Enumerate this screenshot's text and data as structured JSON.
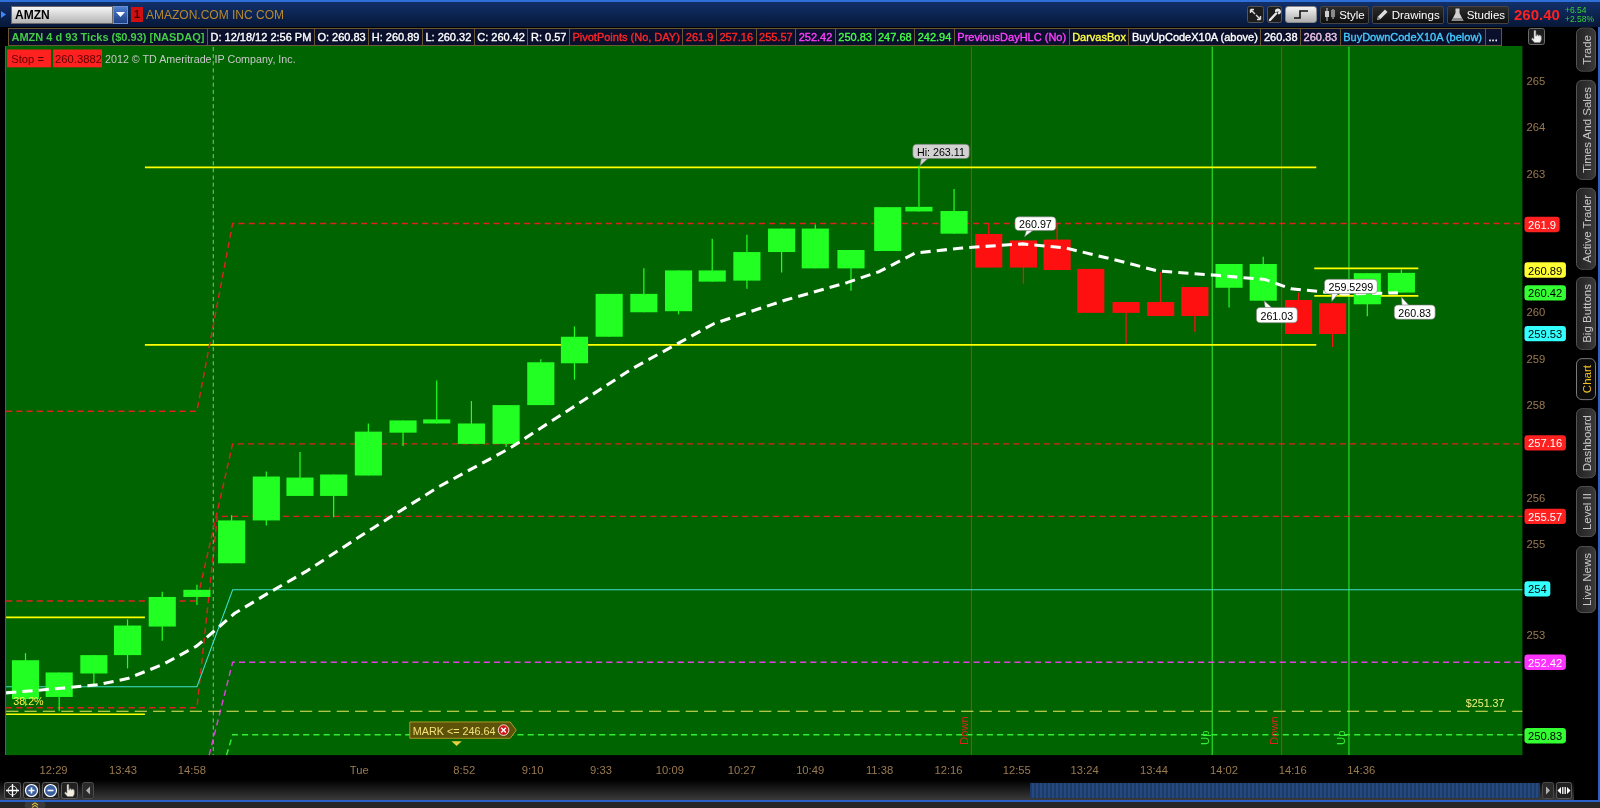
{
  "top_bar": {
    "symbol": "AMZN",
    "link_badge": "1",
    "company": "AMAZON.COM INC COM",
    "buttons": [
      {
        "label": "Style"
      },
      {
        "label": "Drawings"
      },
      {
        "label": "Studies"
      }
    ],
    "last_price": "260.40",
    "net_change": "+6.54",
    "percent_change": "+2.58%"
  },
  "legend": [
    {
      "kind": "title",
      "text": "AMZN 4 d 93 Ticks ($0.93) [NASDAQ]",
      "color": "#44cc44"
    },
    {
      "kind": "item",
      "text": "D: 12/18/12 2:56 PM",
      "color": "#ffffff"
    },
    {
      "kind": "item",
      "text": "O: 260.83",
      "color": "#ffffff"
    },
    {
      "kind": "item",
      "text": "H: 260.89",
      "color": "#ffffff"
    },
    {
      "kind": "item",
      "text": "L: 260.32",
      "color": "#ffffff"
    },
    {
      "kind": "item",
      "text": "C: 260.42",
      "color": "#ffffff"
    },
    {
      "kind": "item",
      "text": "R: 0.57",
      "color": "#ffffff"
    },
    {
      "kind": "item",
      "text": "PivotPoints (No, DAY)",
      "color": "#ff2626"
    },
    {
      "kind": "item",
      "text": "261.9",
      "color": "#ff2626"
    },
    {
      "kind": "item",
      "text": "257.16",
      "color": "#ff2626"
    },
    {
      "kind": "item",
      "text": "255.57",
      "color": "#ff2626"
    },
    {
      "kind": "item",
      "text": "252.42",
      "color": "#ff40ff"
    },
    {
      "kind": "item",
      "text": "250.83",
      "color": "#44ff44"
    },
    {
      "kind": "item",
      "text": "247.68",
      "color": "#44ff44"
    },
    {
      "kind": "item",
      "text": "242.94",
      "color": "#44ff44"
    },
    {
      "kind": "item",
      "text": "PreviousDayHLC (No)",
      "color": "#ff40ff"
    },
    {
      "kind": "item",
      "text": "DarvasBox",
      "color": "#ffff40"
    },
    {
      "kind": "item",
      "text": "BuyUpCodeX10A (above)",
      "color": "#ffffff"
    },
    {
      "kind": "item",
      "text": "260.38",
      "color": "#ffffff"
    },
    {
      "kind": "item",
      "text": "260.83",
      "color": "#f0c8e8"
    },
    {
      "kind": "item",
      "text": "BuyDownCodeX10A (below)",
      "color": "#44ccff"
    },
    {
      "kind": "more",
      "text": "..."
    }
  ],
  "chart": {
    "stop_label": "Stop =",
    "stop_value": "260.3882",
    "copyright": "2012 © TD Ameritrade IP Company, Inc.",
    "price_ticks": [
      "265",
      "264",
      "263",
      "260",
      "259",
      "258",
      "256",
      "255",
      "253"
    ],
    "price_tags": [
      {
        "text": "261.9",
        "color": "#ff2020"
      },
      {
        "text": "260.89",
        "color": "#ffff33"
      },
      {
        "text": "260.42",
        "color": "#33ff33"
      },
      {
        "text": "259.53",
        "color": "#33ffff"
      },
      {
        "text": "257.16",
        "color": "#ff2020"
      },
      {
        "text": "255.57",
        "color": "#ff2020"
      },
      {
        "text": "254",
        "color": "#33ffff"
      },
      {
        "text": "252.42",
        "color": "#ff33ff"
      },
      {
        "text": "250.83",
        "color": "#33ff33"
      }
    ],
    "callouts": [
      {
        "kind": "high",
        "text": "Hi: 263.11"
      },
      {
        "kind": "value",
        "text": "260.97"
      },
      {
        "kind": "value",
        "text": "261.03"
      },
      {
        "kind": "value",
        "text": "259.5299"
      },
      {
        "kind": "value",
        "text": "260.83"
      }
    ],
    "signals": [
      {
        "text": "Down",
        "color": "#e02020"
      },
      {
        "text": "Up",
        "color": "#33ee33"
      },
      {
        "text": "Down",
        "color": "#e02020"
      },
      {
        "text": "Up",
        "color": "#33ee33"
      }
    ],
    "fib_label": "38.2%",
    "mark_label": "$251.37",
    "order": {
      "text": "MARK <= 246.64"
    },
    "time_labels": [
      "12:29",
      "13:43",
      "14:58",
      "Tue",
      "8:52",
      "9:10",
      "9:33",
      "10:09",
      "10:27",
      "10:49",
      "11:38",
      "12:16",
      "12:55",
      "13:24",
      "13:44",
      "14:02",
      "14:16",
      "14:36"
    ]
  },
  "side_tabs": [
    {
      "label": "Trade",
      "selected": false
    },
    {
      "label": "Times And Sales",
      "selected": false
    },
    {
      "label": "Active Trader",
      "selected": false
    },
    {
      "label": "Big Buttons",
      "selected": false
    },
    {
      "label": "Chart",
      "selected": true
    },
    {
      "label": "Dashboard",
      "selected": false
    },
    {
      "label": "Level II",
      "selected": false
    },
    {
      "label": "Live News",
      "selected": false
    }
  ]
}
